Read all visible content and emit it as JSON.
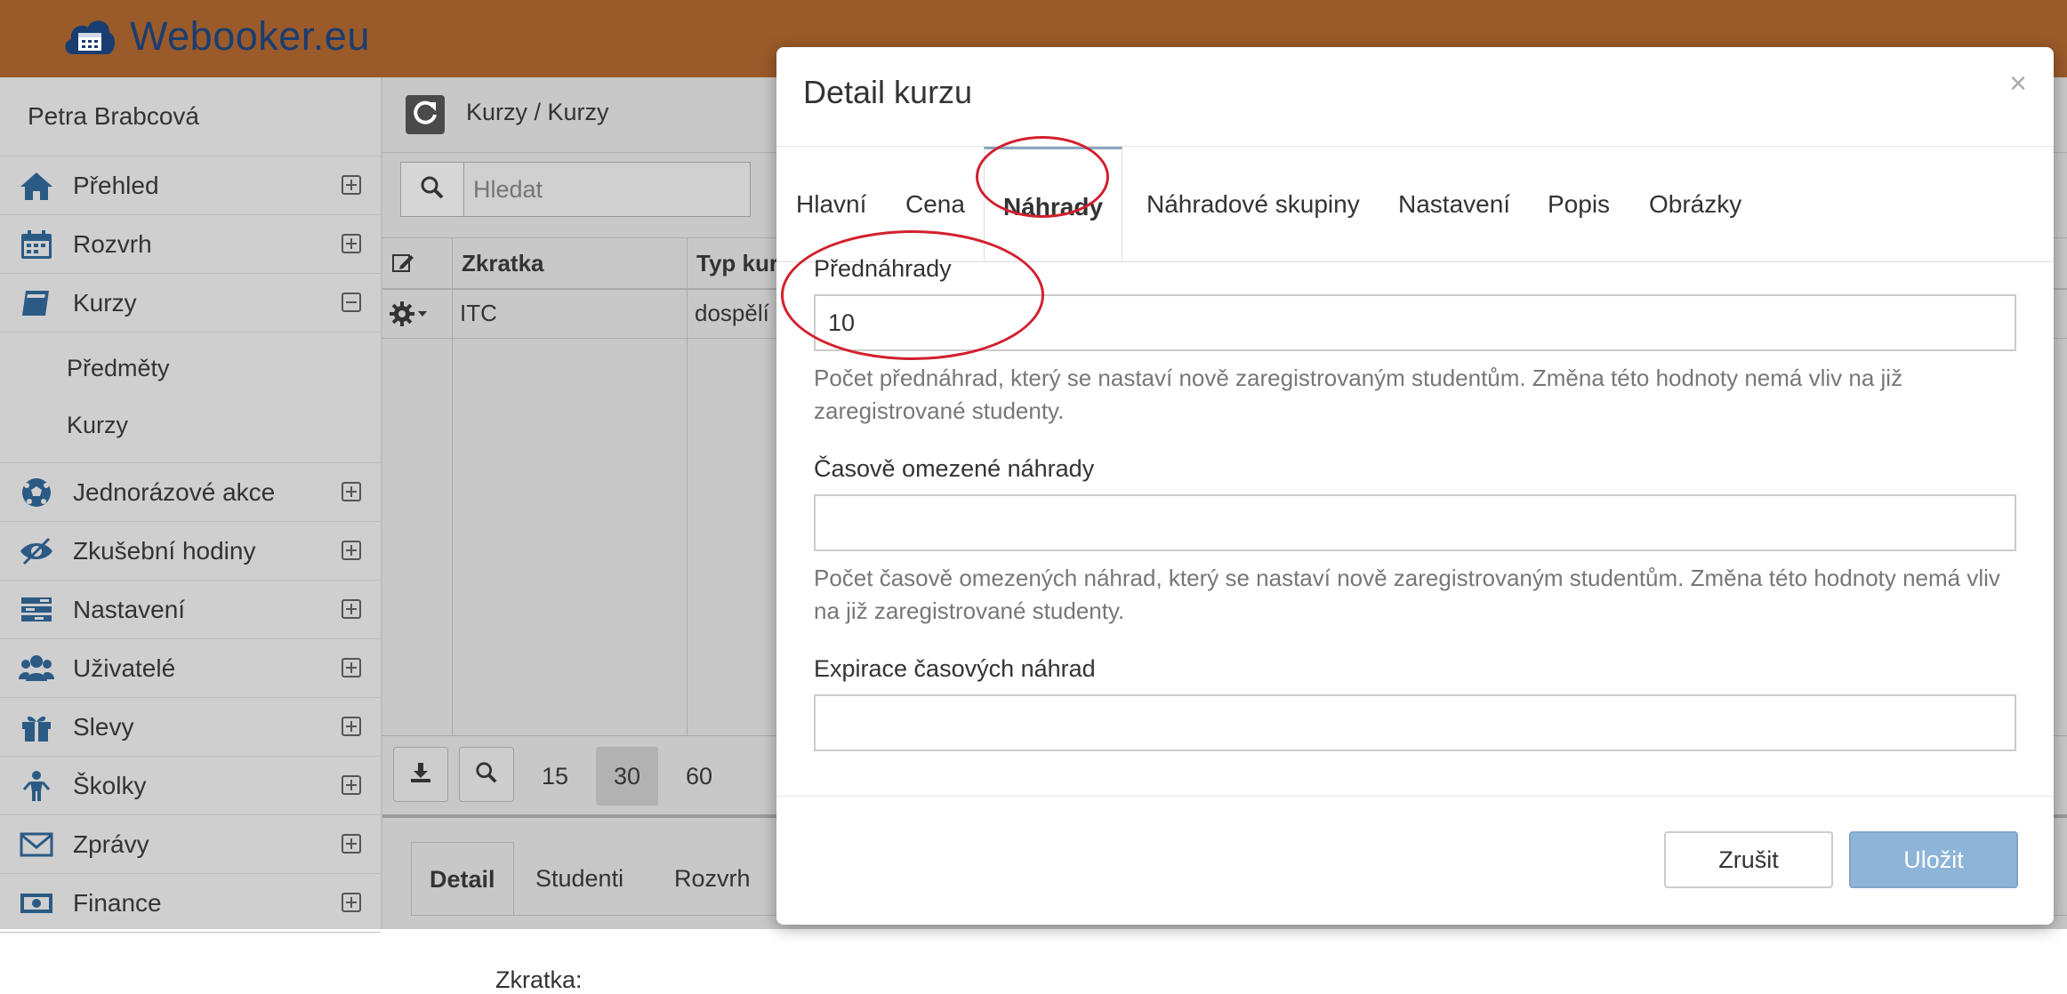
{
  "app": {
    "title": "Webooker.eu"
  },
  "sidebar": {
    "user": "Petra Brabcová",
    "items": [
      {
        "label": "Přehled",
        "icon": "home-icon"
      },
      {
        "label": "Rozvrh",
        "icon": "calendar-icon"
      },
      {
        "label": "Kurzy",
        "icon": "book-icon",
        "expanded": true,
        "children": [
          "Předměty",
          "Kurzy"
        ]
      },
      {
        "label": "Jednorázové akce",
        "icon": "soccer-ball-icon"
      },
      {
        "label": "Zkušební hodiny",
        "icon": "eye-icon"
      },
      {
        "label": "Nastavení",
        "icon": "tasks-icon"
      },
      {
        "label": "Uživatelé",
        "icon": "users-icon"
      },
      {
        "label": "Slevy",
        "icon": "gift-icon"
      },
      {
        "label": "Školky",
        "icon": "child-icon"
      },
      {
        "label": "Zprávy",
        "icon": "envelope-icon"
      },
      {
        "label": "Finance",
        "icon": "money-icon"
      }
    ]
  },
  "main": {
    "breadcrumb": "Kurzy / Kurzy",
    "search_placeholder": "Hledat",
    "grid": {
      "columns": [
        "Zkratka",
        "Typ kurzu"
      ],
      "rows": [
        {
          "zkratka": "ITC",
          "typ": "dospělí"
        }
      ]
    },
    "pager": {
      "sizes": [
        "15",
        "30",
        "60"
      ],
      "active": "30"
    },
    "lower_tabs": [
      "Detail",
      "Studenti",
      "Rozvrh"
    ],
    "lower_field": "Zkratka:"
  },
  "modal": {
    "title": "Detail kurzu",
    "close": "×",
    "tabs": [
      "Hlavní",
      "Cena",
      "Náhrady",
      "Náhradové skupiny",
      "Nastavení",
      "Popis",
      "Obrázky"
    ],
    "active_tab": "Náhrady",
    "fields": [
      {
        "label": "Přednáhrady",
        "value": "10",
        "help": "Počet přednáhrad, který se nastaví nově zaregistrovaným studentům. Změna této hodnoty nemá vliv na již zaregistrované studenty."
      },
      {
        "label": "Časově omezené náhrady",
        "value": "",
        "help": "Počet časově omezených náhrad, který se nastaví nově zaregistrovaným studentům. Změna této hodnoty nemá vliv na již zaregistrované studenty."
      },
      {
        "label": "Expirace časových náhrad",
        "value": ""
      }
    ],
    "cancel_label": "Zrušit",
    "save_label": "Uložit"
  },
  "colors": {
    "header": "#9b5a2a",
    "brand_text": "#1a3d70",
    "save_button": "#8eb4d8",
    "annotation": "#d2202d"
  }
}
